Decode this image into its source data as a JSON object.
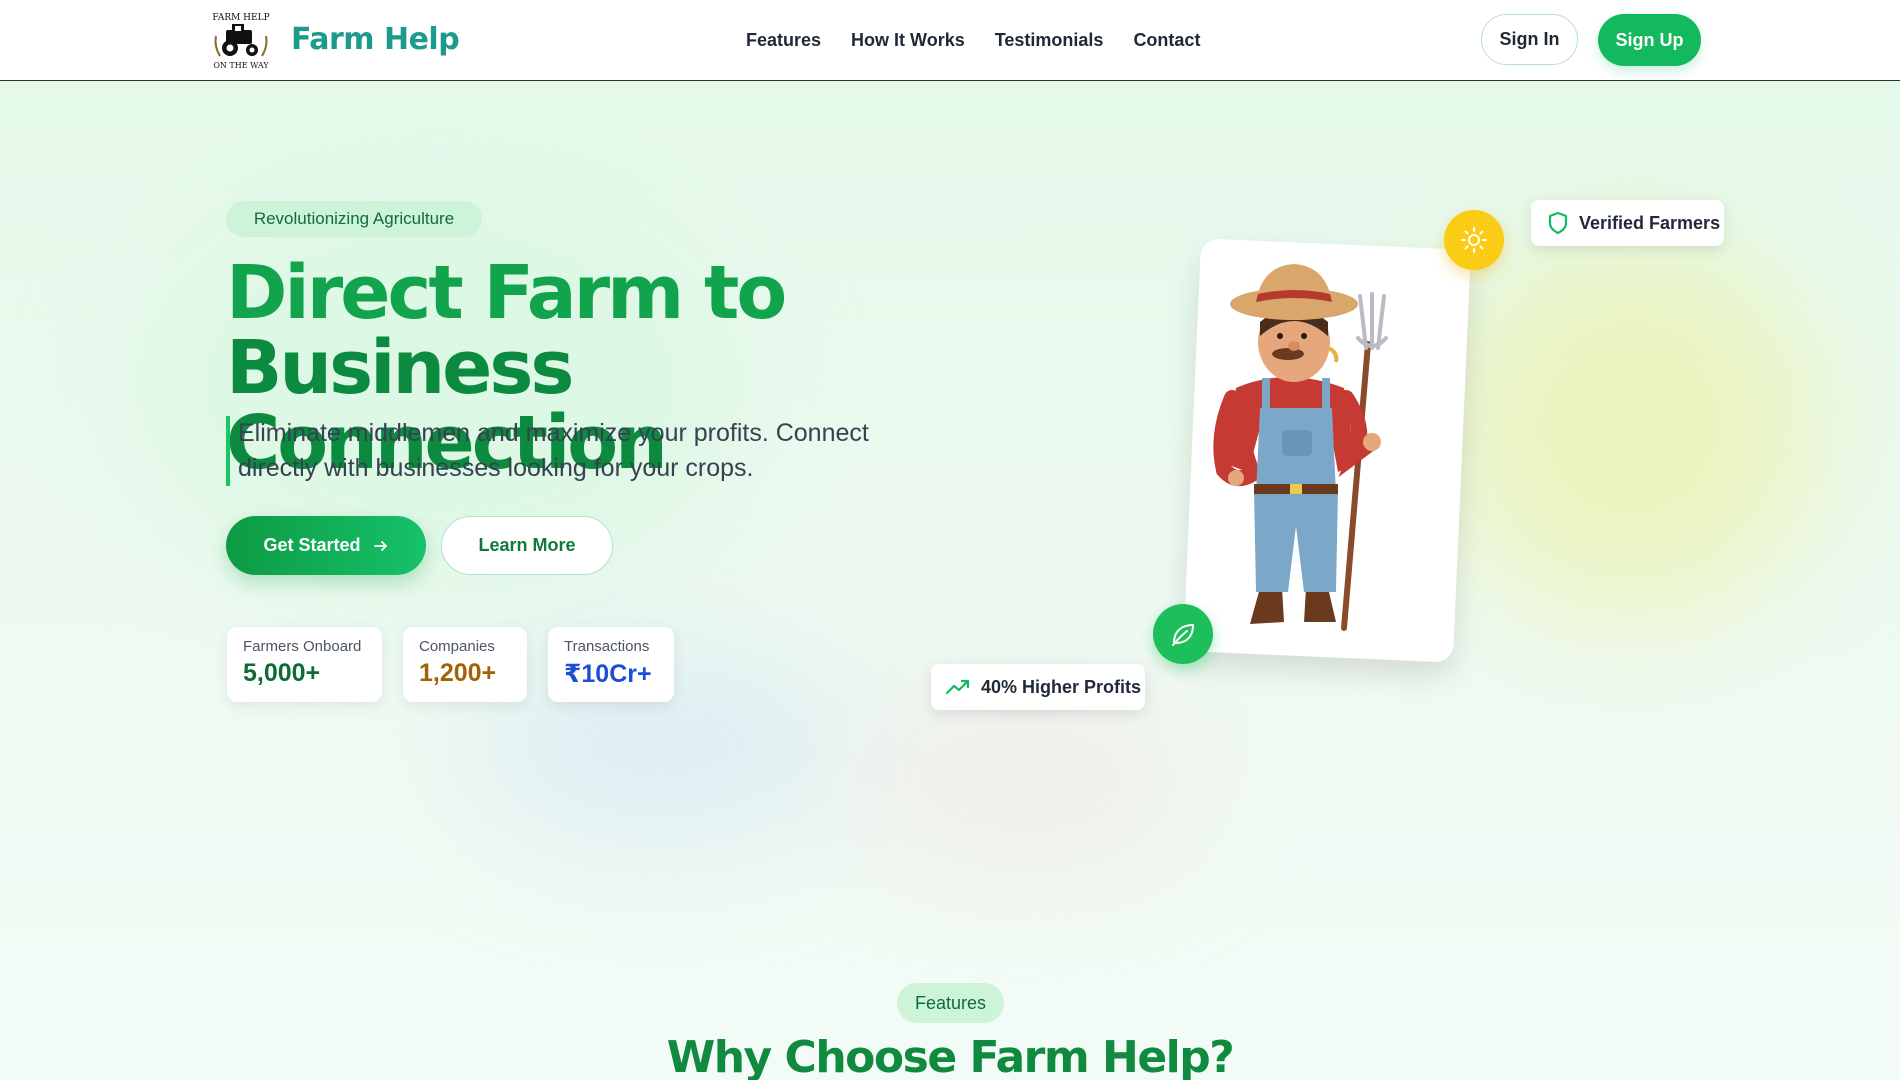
{
  "header": {
    "brand": "Farm Help",
    "logo_text_top": "FARM HELP",
    "logo_text_bottom": "ON THE WAY",
    "nav": [
      "Features",
      "How It Works",
      "Testimonials",
      "Contact"
    ],
    "sign_in": "Sign In",
    "sign_up": "Sign Up"
  },
  "hero": {
    "badge": "Revolutionizing Agriculture",
    "title_line1": "Direct Farm to",
    "title_line2": "Business Connection",
    "subtitle": "Eliminate middlemen and maximize your profits. Connect directly with businesses looking for your crops.",
    "get_started": "Get Started",
    "learn_more": "Learn More",
    "stats": [
      {
        "label": "Farmers Onboard",
        "value": "5,000+"
      },
      {
        "label": "Companies",
        "value": "1,200+"
      },
      {
        "label": "Transactions",
        "value": "₹10Cr+"
      }
    ]
  },
  "illustration": {
    "verified": "Verified Farmers",
    "profits": "40% Higher Profits"
  },
  "features": {
    "badge": "Features",
    "title": "Why Choose Farm Help?"
  },
  "colors": {
    "primary": "#13b95d",
    "brand": "#1c9b8c",
    "title_green": "#12a34d",
    "sun": "#facc15"
  },
  "icons": [
    "logo-icon",
    "arrow-right-icon",
    "sun-icon",
    "leaf-icon",
    "shield-icon",
    "trending-up-icon"
  ]
}
